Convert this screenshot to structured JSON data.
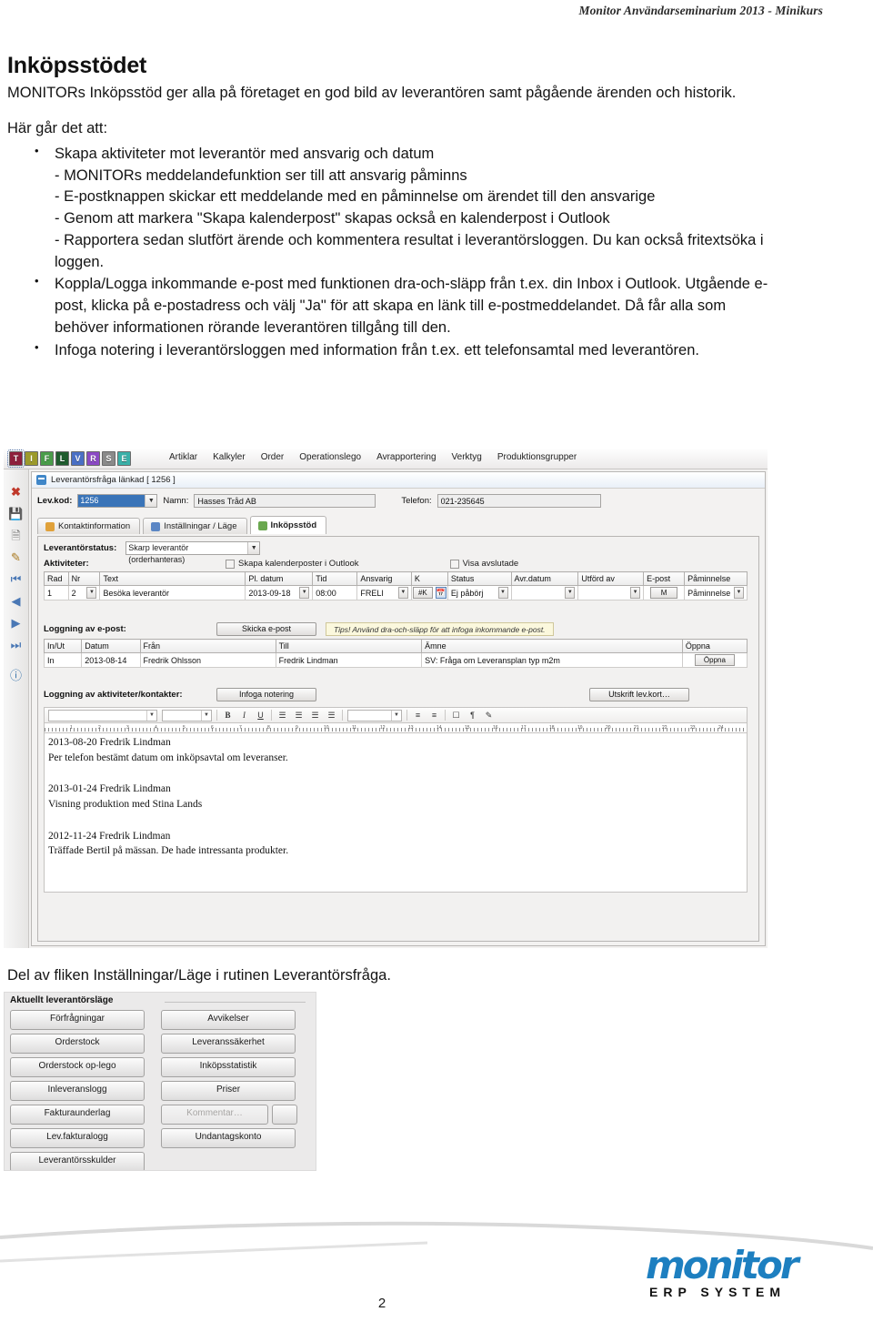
{
  "document": {
    "running_header": "Monitor Användarseminarium 2013 - Minikurs",
    "page_number": "2",
    "title": "Inköpsstödet",
    "lead": "MONITORs Inköpsstöd ger alla på företaget en god bild av leverantören samt pågående ärenden och historik.",
    "intro": "Här går det att:",
    "bullets": [
      {
        "main": "Skapa aktiviteter mot leverantör med ansvarig och datum",
        "subs": [
          "- MONITORs meddelandefunktion ser till att ansvarig påminns",
          "- E-postknappen skickar ett meddelande med en påminnelse om ärendet till den ansvarige",
          "- Genom att markera \"Skapa kalenderpost\" skapas också en kalenderpost i Outlook",
          "- Rapportera sedan slutfört ärende och kommentera resultat i leverantörsloggen. Du kan också fritextsöka i loggen."
        ]
      },
      {
        "main": "Koppla/Logga inkommande e-post med funktionen dra-och-släpp från t.ex. din Inbox i Outlook. Utgående e-post, klicka på e-postadress och välj \"Ja\" för att skapa en länk till e-postmeddelandet. Då får alla som behöver informationen rörande leverantören tillgång till den.",
        "subs": []
      },
      {
        "main": "Infoga notering i leverantörsloggen med information från t.ex. ett telefonsamtal med leverantören.",
        "subs": []
      }
    ],
    "caption": "Del av fliken Inställningar/Läge i rutinen Leverantörsfråga."
  },
  "screenshot": {
    "quick_icons": [
      {
        "letter": "T",
        "color": "#8e1f3b"
      },
      {
        "letter": "I",
        "color": "#9c9a2b"
      },
      {
        "letter": "F",
        "color": "#4a9c4a"
      },
      {
        "letter": "L",
        "color": "#1f5c2e"
      },
      {
        "letter": "V",
        "color": "#4a6fc4"
      },
      {
        "letter": "R",
        "color": "#8b4ac4"
      },
      {
        "letter": "S",
        "color": "#8a8a8a"
      },
      {
        "letter": "E",
        "color": "#3ab0a8"
      }
    ],
    "menu": [
      "Artiklar",
      "Kalkyler",
      "Order",
      "Operationslego",
      "Avrapportering",
      "Verktyg",
      "Produktionsgrupper"
    ],
    "window_title": "Leverantörsfråga länkad [ 1256 ]",
    "fields": {
      "levkod_label": "Lev.kod:",
      "levkod_value": "1256",
      "namn_label": "Namn:",
      "namn_value": "Hasses Tråd AB",
      "telefon_label": "Telefon:",
      "telefon_value": "021-235645"
    },
    "tabs": [
      {
        "label": "Kontaktinformation",
        "active": false,
        "color": "#e0a13a"
      },
      {
        "label": "Inställningar / Läge",
        "active": false,
        "color": "#5b86c4"
      },
      {
        "label": "Inköpsstöd",
        "active": true,
        "color": "#6aa84f"
      }
    ],
    "status": {
      "label": "Leverantörstatus:",
      "value": "Skarp leverantör (orderhanteras)"
    },
    "activities": {
      "label": "Aktiviteter:",
      "checkbox_calendar": "Skapa kalenderposter i Outlook",
      "checkbox_closed": "Visa avslutade",
      "columns": [
        "Rad",
        "Nr",
        "Text",
        "Pl. datum",
        "Tid",
        "Ansvarig",
        "K",
        "Status",
        "Avr.datum",
        "Utförd av",
        "E-post",
        "Påminnelse"
      ],
      "rows": [
        {
          "rad": "1",
          "nr": "2",
          "text": "Besöka leverantör",
          "pl_datum": "2013-09-18",
          "tid": "08:00",
          "ansvarig": "FRELI",
          "k": "#K",
          "status": "Ej påbörj",
          "avr_datum": "",
          "utford_av": "",
          "epost": "M",
          "paminnelse": "Påminnelse"
        }
      ]
    },
    "email_log": {
      "label": "Loggning av e-post:",
      "send_button": "Skicka e-post",
      "tip": "Tips! Använd dra-och-släpp för att infoga inkommande e-post.",
      "columns": [
        "In/Ut",
        "Datum",
        "Från",
        "Till",
        "Ämne",
        "Öppna"
      ],
      "rows": [
        {
          "inut": "In",
          "datum": "2013-08-14",
          "fran": "Fredrik Ohlsson",
          "till": "Fredrik Lindman",
          "amne": "SV: Fråga om Leveransplan typ m2m",
          "open": "Öppna"
        }
      ]
    },
    "activity_log": {
      "label": "Loggning av aktiviteter/kontakter:",
      "insert_button": "Infoga notering",
      "print_button": "Utskrift lev.kort…",
      "ruler_ticks": [
        "1",
        "2",
        "3",
        "4",
        "5",
        "6",
        "7",
        "8",
        "9",
        "10",
        "11",
        "12",
        "13",
        "14",
        "15",
        "16",
        "17",
        "18",
        "19",
        "20",
        "21",
        "22",
        "23",
        "24"
      ],
      "entries": [
        {
          "date_author": "2013-08-20 Fredrik Lindman",
          "body": "Per telefon bestämt datum om inköpsavtal om leveranser."
        },
        {
          "date_author": "2013-01-24 Fredrik Lindman",
          "body": "Visning produktion med Stina Lands"
        },
        {
          "date_author": "2012-11-24 Fredrik Lindman",
          "body": "Träffade Bertil på mässan. De hade intressanta produkter."
        }
      ]
    }
  },
  "supplier_mode_panel": {
    "title": "Aktuellt leverantörsläge",
    "left_buttons": [
      "Förfrågningar",
      "Orderstock",
      "Orderstock op-lego",
      "Inleveranslogg",
      "Fakturaunderlag",
      "Lev.fakturalogg",
      "Leverantörsskulder"
    ],
    "right_buttons": [
      {
        "label": "Avvikelser",
        "disabled": false
      },
      {
        "label": "Leveranssäkerhet",
        "disabled": false
      },
      {
        "label": "Inköpsstatistik",
        "disabled": false
      },
      {
        "label": "Priser",
        "disabled": false
      },
      {
        "label": "Kommentar…",
        "disabled": true
      },
      {
        "label": "Undantagskonto",
        "disabled": false
      }
    ]
  },
  "footer": {
    "logo_word": "monitor",
    "logo_sub": "ERP SYSTEM"
  }
}
